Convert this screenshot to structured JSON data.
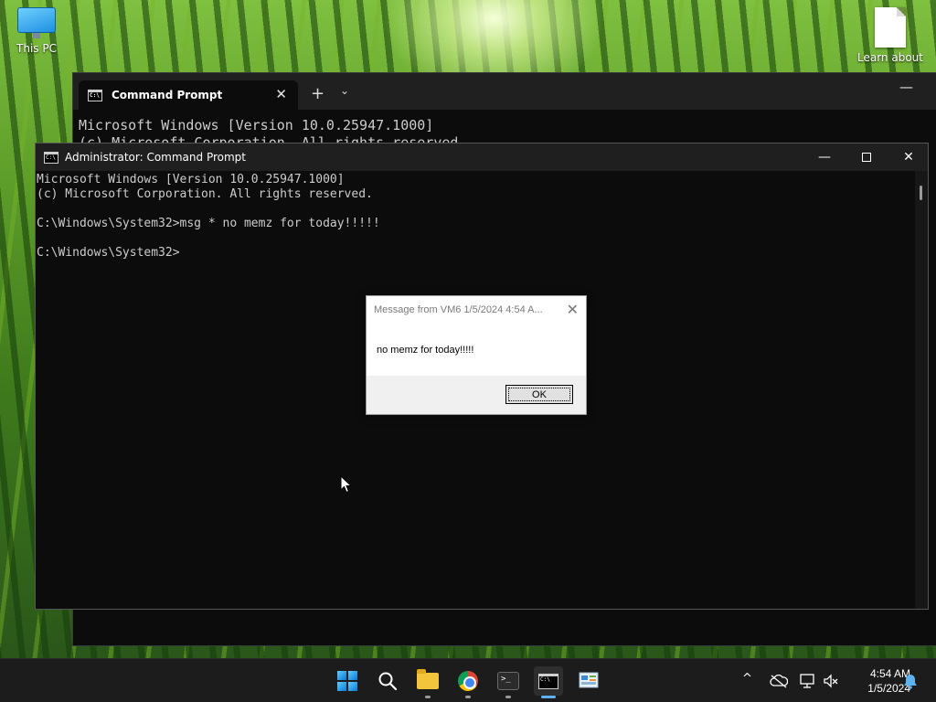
{
  "desktop": {
    "icons": [
      {
        "label": "This PC"
      },
      {
        "label": "Learn about"
      }
    ]
  },
  "terminal_back": {
    "tab_title": "Command Prompt",
    "tab_close": "✕",
    "new_tab": "+",
    "tab_dropdown": "⌄",
    "minimize": "—",
    "lines": [
      "Microsoft Windows [Version 10.0.25947.1000]",
      "(c) Microsoft Corporation. All rights reserved."
    ]
  },
  "cmd_window": {
    "title": "Administrator: Command Prompt",
    "minimize": "—",
    "close": "✕",
    "console_text": "Microsoft Windows [Version 10.0.25947.1000]\n(c) Microsoft Corporation. All rights reserved.\n\nC:\\Windows\\System32>msg * no memz for today!!!!!\n\nC:\\Windows\\System32>"
  },
  "message_box": {
    "title": "Message from VM6 1/5/2024 4:54 A...",
    "close": "✕",
    "text": "no memz for today!!!!!",
    "ok_label": "OK"
  },
  "taskbar": {
    "items": [
      "start",
      "search",
      "file-explorer",
      "chrome",
      "terminal",
      "command-prompt",
      "control-panel"
    ],
    "active_item": "command-prompt",
    "tray_chevron": "^"
  },
  "clock": {
    "time": "4:54 AM",
    "date": "1/5/2024"
  },
  "colors": {
    "taskbar_accent": "#5fb2f2",
    "console_text": "#cccccc",
    "console_bg": "#0c0c0c"
  }
}
